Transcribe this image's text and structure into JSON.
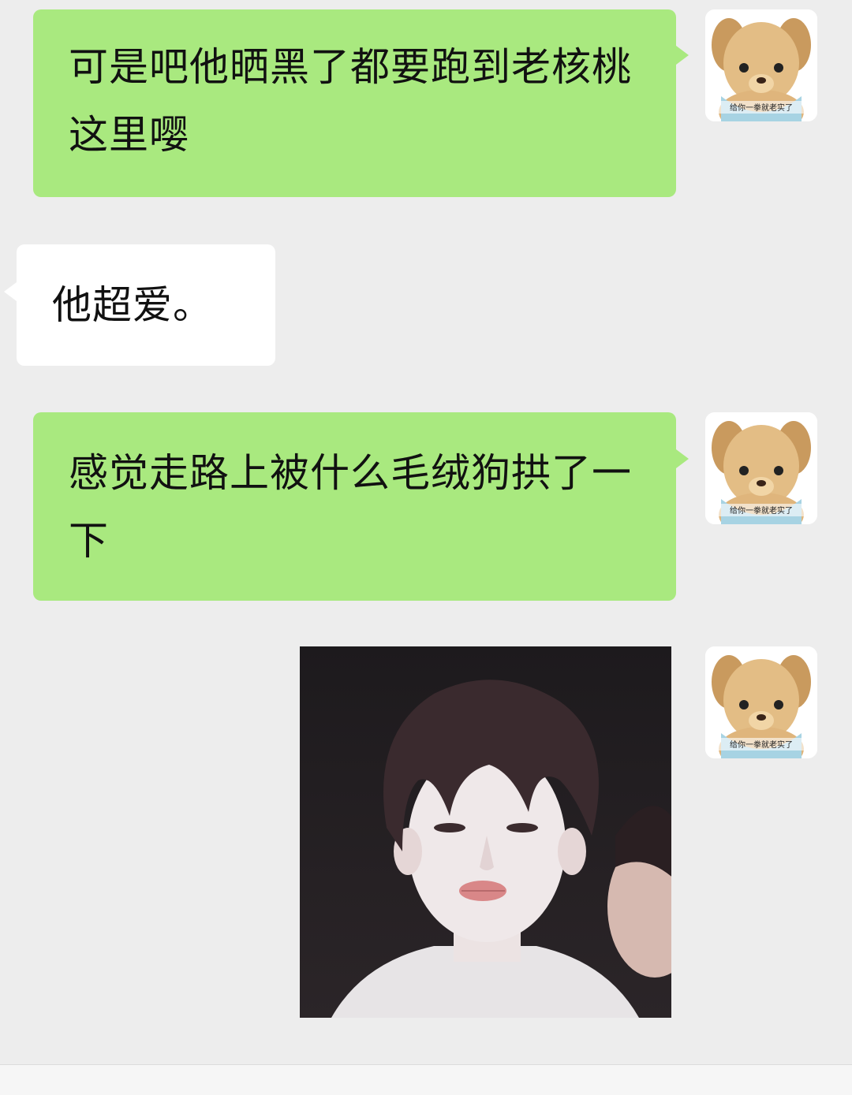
{
  "messages": [
    {
      "from": "me",
      "text": "可是吧他晒黑了都要跑到老核桃这里嘤"
    },
    {
      "from": "other",
      "text": "他超爱。"
    },
    {
      "from": "me",
      "text": "感觉走路上被什么毛绒狗拱了一下"
    },
    {
      "from": "me",
      "type": "image",
      "image_name": "sticker-photo-pouting-boy"
    }
  ],
  "avatar": {
    "caption": "给你一拳就老实了",
    "icon": "teddy-bear-avatar"
  },
  "colors": {
    "sent_bubble": "#a9e97f",
    "received_bubble": "#ffffff",
    "background": "#ededed"
  }
}
